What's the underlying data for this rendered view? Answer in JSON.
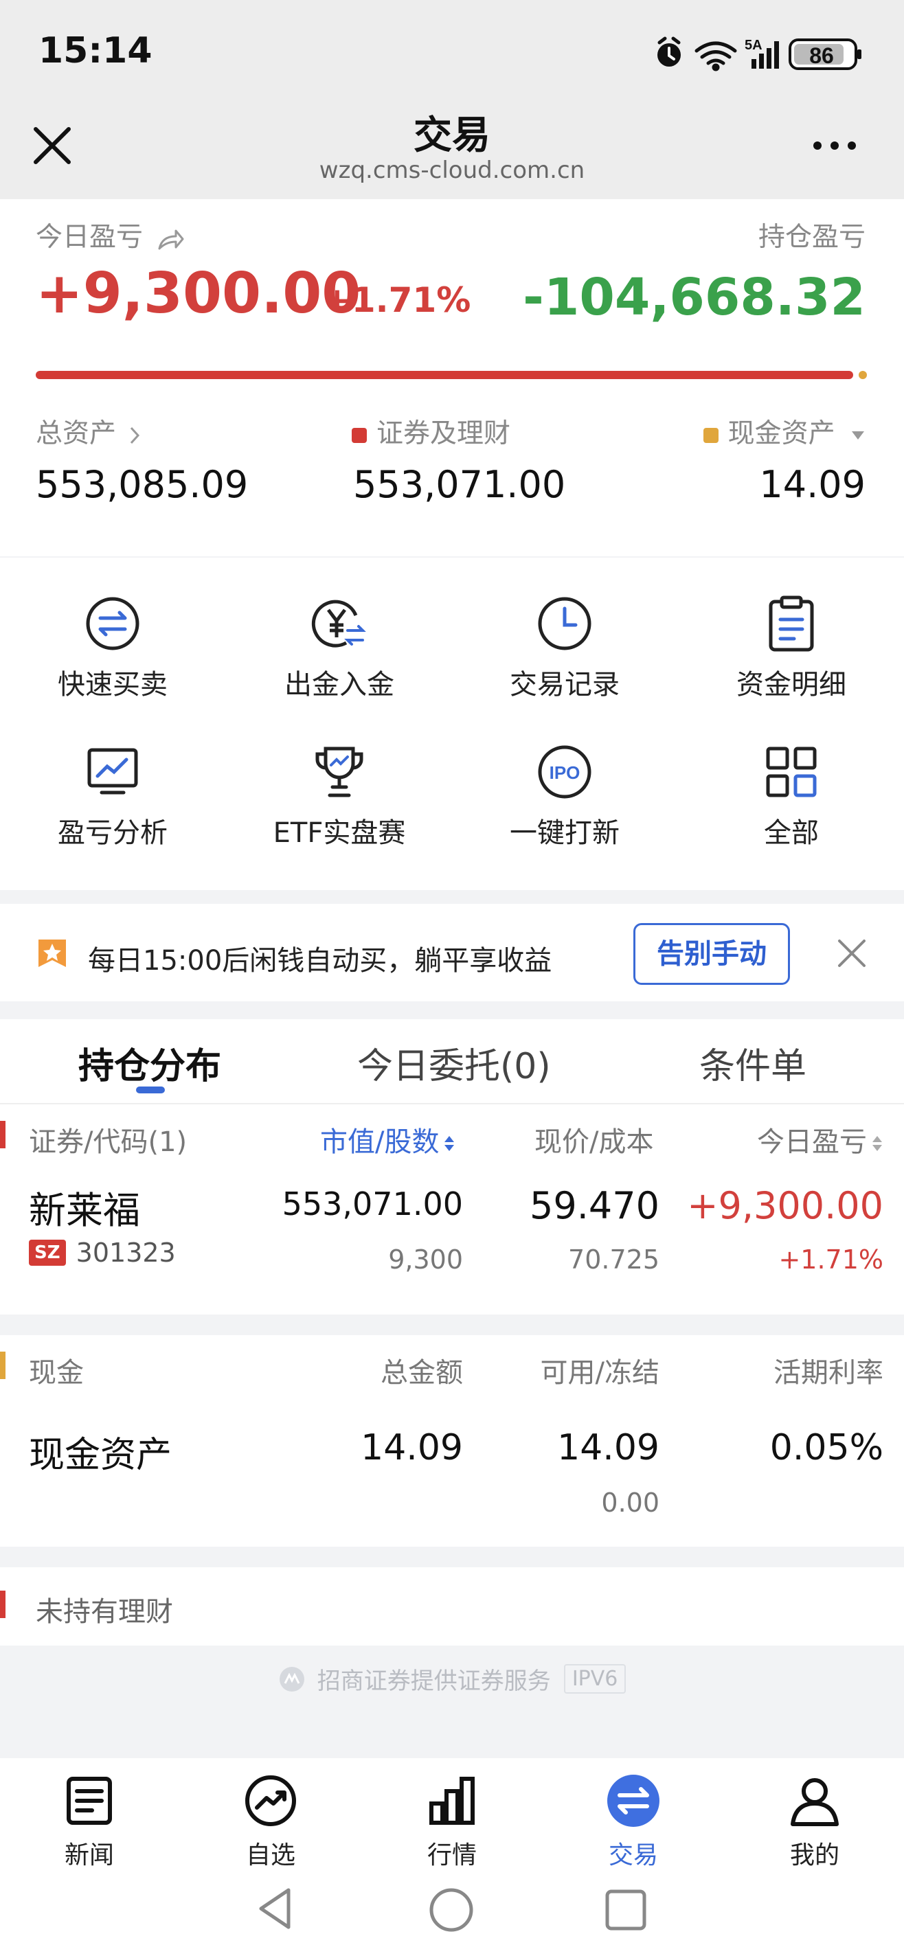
{
  "status_bar": {
    "time": "15:14",
    "battery": "86",
    "network": "5A"
  },
  "header": {
    "title": "交易",
    "url": "wzq.cms-cloud.com.cn"
  },
  "summary": {
    "today_pnl_label": "今日盈亏",
    "today_pnl_value": "+9,300.00",
    "today_pnl_pct": "+1.71%",
    "holding_pnl_label": "持仓盈亏",
    "holding_pnl_value": "-104,668.32",
    "securities_share": 0.99,
    "total_assets_label": "总资产",
    "total_assets_value": "553,085.09",
    "securities_label": "证券及理财",
    "securities_value": "553,071.00",
    "cash_label": "现金资产",
    "cash_value": "14.09",
    "colors": {
      "securities": "#d33b35",
      "cash": "#e0a63c"
    }
  },
  "quick_actions": [
    {
      "label": "快速买卖",
      "icon": "swap-arrows-icon"
    },
    {
      "label": "出金入金",
      "icon": "yen-transfer-icon"
    },
    {
      "label": "交易记录",
      "icon": "clock-icon"
    },
    {
      "label": "资金明细",
      "icon": "clipboard-icon"
    },
    {
      "label": "盈亏分析",
      "icon": "chart-monitor-icon"
    },
    {
      "label": "ETF实盘赛",
      "icon": "trophy-icon"
    },
    {
      "label": "一键打新",
      "icon": "ipo-icon"
    },
    {
      "label": "全部",
      "icon": "grid-icon"
    }
  ],
  "banner": {
    "text": "每日15:00后闲钱自动买，躺平享收益",
    "button": "告别手动"
  },
  "tabs": [
    "持仓分布",
    "今日委托(0)",
    "条件单"
  ],
  "holdings": {
    "headers": [
      "证券/代码(1)",
      "市值/股数",
      "现价/成本",
      "今日盈亏"
    ],
    "rows": [
      {
        "name": "新莱福",
        "market": "SZ",
        "code": "301323",
        "market_value": "553,071.00",
        "shares": "9,300",
        "price": "59.470",
        "cost": "70.725",
        "pnl": "+9,300.00",
        "pnl_pct": "+1.71%"
      }
    ]
  },
  "cash_section": {
    "headers": [
      "现金",
      "总金额",
      "可用/冻结",
      "活期利率"
    ],
    "row": {
      "name": "现金资产",
      "total": "14.09",
      "available": "14.09",
      "frozen": "0.00",
      "rate": "0.05%"
    }
  },
  "wealth_section": {
    "label": "未持有理财"
  },
  "footer": {
    "text": "招商证券提供证券服务",
    "badge": "IPV6"
  },
  "bottom_nav": [
    {
      "label": "新闻",
      "icon": "news-icon"
    },
    {
      "label": "自选",
      "icon": "trend-icon"
    },
    {
      "label": "行情",
      "icon": "bar-chart-icon"
    },
    {
      "label": "交易",
      "icon": "trade-icon",
      "active": true
    },
    {
      "label": "我的",
      "icon": "user-icon"
    }
  ]
}
